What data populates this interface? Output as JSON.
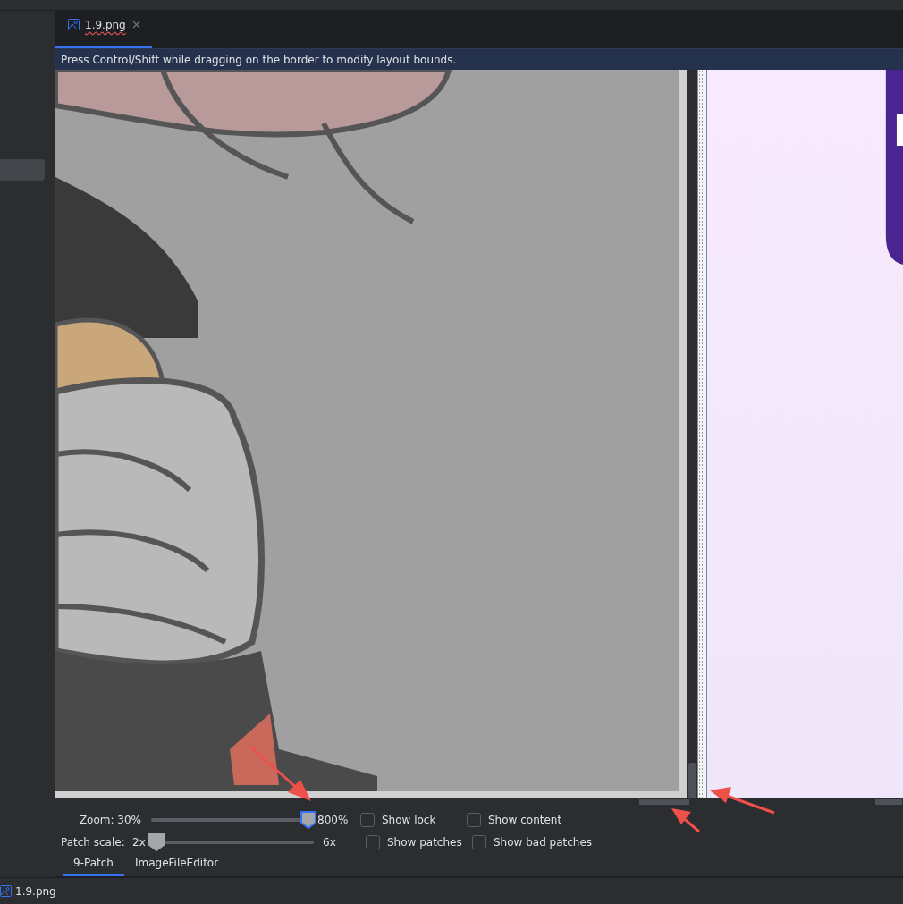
{
  "editor_tab": {
    "label": "1.9.png",
    "close": "×",
    "selected": true
  },
  "hint_bar": {
    "text": "Press Control/Shift while dragging on the border to modify layout bounds."
  },
  "zoom": {
    "label": "Zoom: 30%",
    "max_label": "800%",
    "level": 1.0,
    "focused": true
  },
  "patch_scale": {
    "label": "Patch scale:",
    "min_label": "2x",
    "max_label": "6x",
    "level": 0.0,
    "focused": false
  },
  "checkboxes": [
    {
      "label": "Show lock",
      "checked": false
    },
    {
      "label": "Show content",
      "checked": false
    },
    {
      "label": "Show patches",
      "checked": false
    },
    {
      "label": "Show bad patches",
      "checked": false
    }
  ],
  "bottom_tabs": [
    {
      "label": "9-Patch",
      "selected": true
    },
    {
      "label": "ImageFileEditor",
      "selected": false
    }
  ],
  "status_bar": {
    "file": "1.9.png"
  }
}
